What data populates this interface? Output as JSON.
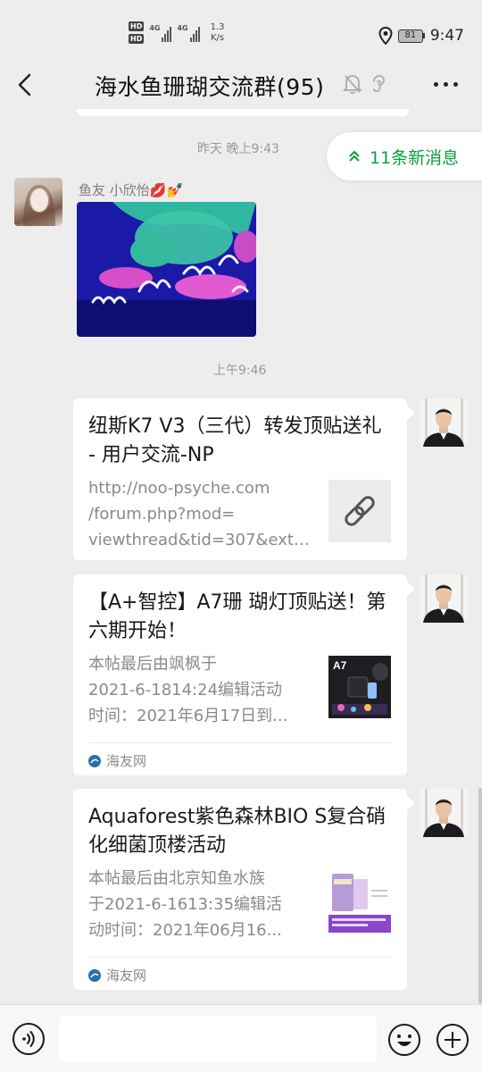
{
  "status_bar": {
    "hd1": "HD",
    "hd2": "HD",
    "net1": "4G",
    "net2": "4G",
    "speed_value": "1.3",
    "speed_unit": "K/s",
    "battery": "81",
    "time": "9:47"
  },
  "nav": {
    "title": "海水鱼珊瑚交流群(95)"
  },
  "chat": {
    "time1": "昨天 晚上9:43",
    "new_messages": "11条新消息",
    "sender_name": "鱼友 小欣怡💋💅",
    "time2": "上午9:46",
    "cards": [
      {
        "title": "纽斯K7 V3（三代）转发顶贴送礼 - 用户交流-NP",
        "desc_lines": [
          "http://noo-psyche.com",
          "/forum.php?mod=",
          "viewthread&tid=307&extr..."
        ]
      },
      {
        "title": "【A+智控】A7珊 瑚灯顶贴送！第六期开始！",
        "desc_lines": [
          "本帖最后由飒枫于",
          "2021-6-1814:24编辑活动",
          "时间：2021年6月17日到..."
        ],
        "thumb_label": "A7",
        "source": "海友网"
      },
      {
        "title": "Aquaforest紫色森林BIO S复合硝化细菌顶楼活动",
        "desc_lines": [
          "本帖最后由北京知鱼水族",
          "于2021-6-1613:35编辑活",
          "动时间：2021年06月16..."
        ],
        "source": "海友网"
      }
    ]
  },
  "input_bar": {
    "placeholder": ""
  },
  "colors": {
    "accent_green": "#07a13c",
    "background": "#ededed"
  }
}
